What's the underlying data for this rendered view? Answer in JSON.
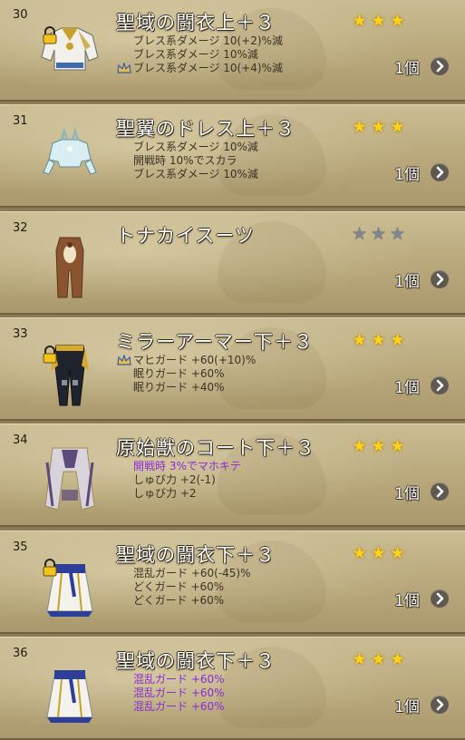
{
  "items": [
    {
      "num": "30",
      "name": "聖域の闘衣上＋３",
      "stars": 3,
      "locked": true,
      "garment": "top",
      "colors": {
        "main": "#f2f0ea",
        "accent": "#c8a12a",
        "trim": "#3d6bb0"
      },
      "effects": [
        {
          "text": "ブレス系ダメージ 10(+2)%減",
          "purple": false,
          "crown": false
        },
        {
          "text": "ブレス系ダメージ 10%減",
          "purple": false,
          "crown": false
        },
        {
          "text": "ブレス系ダメージ 10(+4)%減",
          "purple": false,
          "crown": true
        }
      ],
      "qty": "1個"
    },
    {
      "num": "31",
      "name": "聖翼のドレス上＋３",
      "stars": 3,
      "locked": false,
      "garment": "dress-top",
      "colors": {
        "main": "#d8eef2",
        "accent": "#ffffff",
        "trim": "#7fb7c6"
      },
      "effects": [
        {
          "text": "ブレス系ダメージ 10%減",
          "purple": false,
          "crown": false
        },
        {
          "text": "開戦時 10%でスカラ",
          "purple": false,
          "crown": false
        },
        {
          "text": "ブレス系ダメージ 10%減",
          "purple": false,
          "crown": false
        }
      ],
      "qty": "1個"
    },
    {
      "num": "32",
      "name": "トナカイスーツ",
      "stars": 0,
      "locked": false,
      "garment": "suit",
      "colors": {
        "main": "#8a5430",
        "accent": "#efe2c8",
        "trim": "#5a3418"
      },
      "effects": [],
      "qty": "1個"
    },
    {
      "num": "33",
      "name": "ミラーアーマー下＋３",
      "stars": 3,
      "locked": true,
      "garment": "pants",
      "colors": {
        "main": "#1f242c",
        "accent": "#d6a92e",
        "trim": "#8a8f99"
      },
      "effects": [
        {
          "text": "マヒガード +60(+10)%",
          "purple": false,
          "crown": true
        },
        {
          "text": "眠りガード +60%",
          "purple": false,
          "crown": false
        },
        {
          "text": "眠りガード +40%",
          "purple": false,
          "crown": false
        }
      ],
      "qty": "1個"
    },
    {
      "num": "34",
      "name": "原始獣のコート下＋３",
      "stars": 3,
      "locked": false,
      "garment": "coat",
      "colors": {
        "main": "#d9d4dc",
        "accent": "#5b4a7a",
        "trim": "#a48a5a"
      },
      "effects": [
        {
          "text": "開戦時 3%でマホキテ",
          "purple": true,
          "crown": false
        },
        {
          "text": "しゅび力 +2(-1)",
          "purple": false,
          "crown": false
        },
        {
          "text": "しゅび力 +2",
          "purple": false,
          "crown": false
        }
      ],
      "qty": "1個"
    },
    {
      "num": "35",
      "name": "聖域の闘衣下＋３",
      "stars": 3,
      "locked": true,
      "garment": "skirt",
      "colors": {
        "main": "#f4f2ec",
        "accent": "#2e3f9a",
        "trim": "#c8a12a"
      },
      "effects": [
        {
          "text": "混乱ガード +60(-45)%",
          "purple": false,
          "crown": false
        },
        {
          "text": "どくガード +60%",
          "purple": false,
          "crown": false
        },
        {
          "text": "どくガード +60%",
          "purple": false,
          "crown": false
        }
      ],
      "qty": "1個"
    },
    {
      "num": "36",
      "name": "聖域の闘衣下＋３",
      "stars": 3,
      "locked": false,
      "garment": "skirt",
      "colors": {
        "main": "#f4f2ec",
        "accent": "#2e3f9a",
        "trim": "#c8a12a"
      },
      "effects": [
        {
          "text": "混乱ガード +60%",
          "purple": true,
          "crown": false
        },
        {
          "text": "混乱ガード +60%",
          "purple": true,
          "crown": false
        },
        {
          "text": "混乱ガード +60%",
          "purple": true,
          "crown": false
        }
      ],
      "qty": "1個"
    }
  ],
  "icons": {
    "lock": "padlock-icon",
    "crown": "crown-icon",
    "arrow": "chevron-right-icon",
    "star": "star-icon"
  }
}
